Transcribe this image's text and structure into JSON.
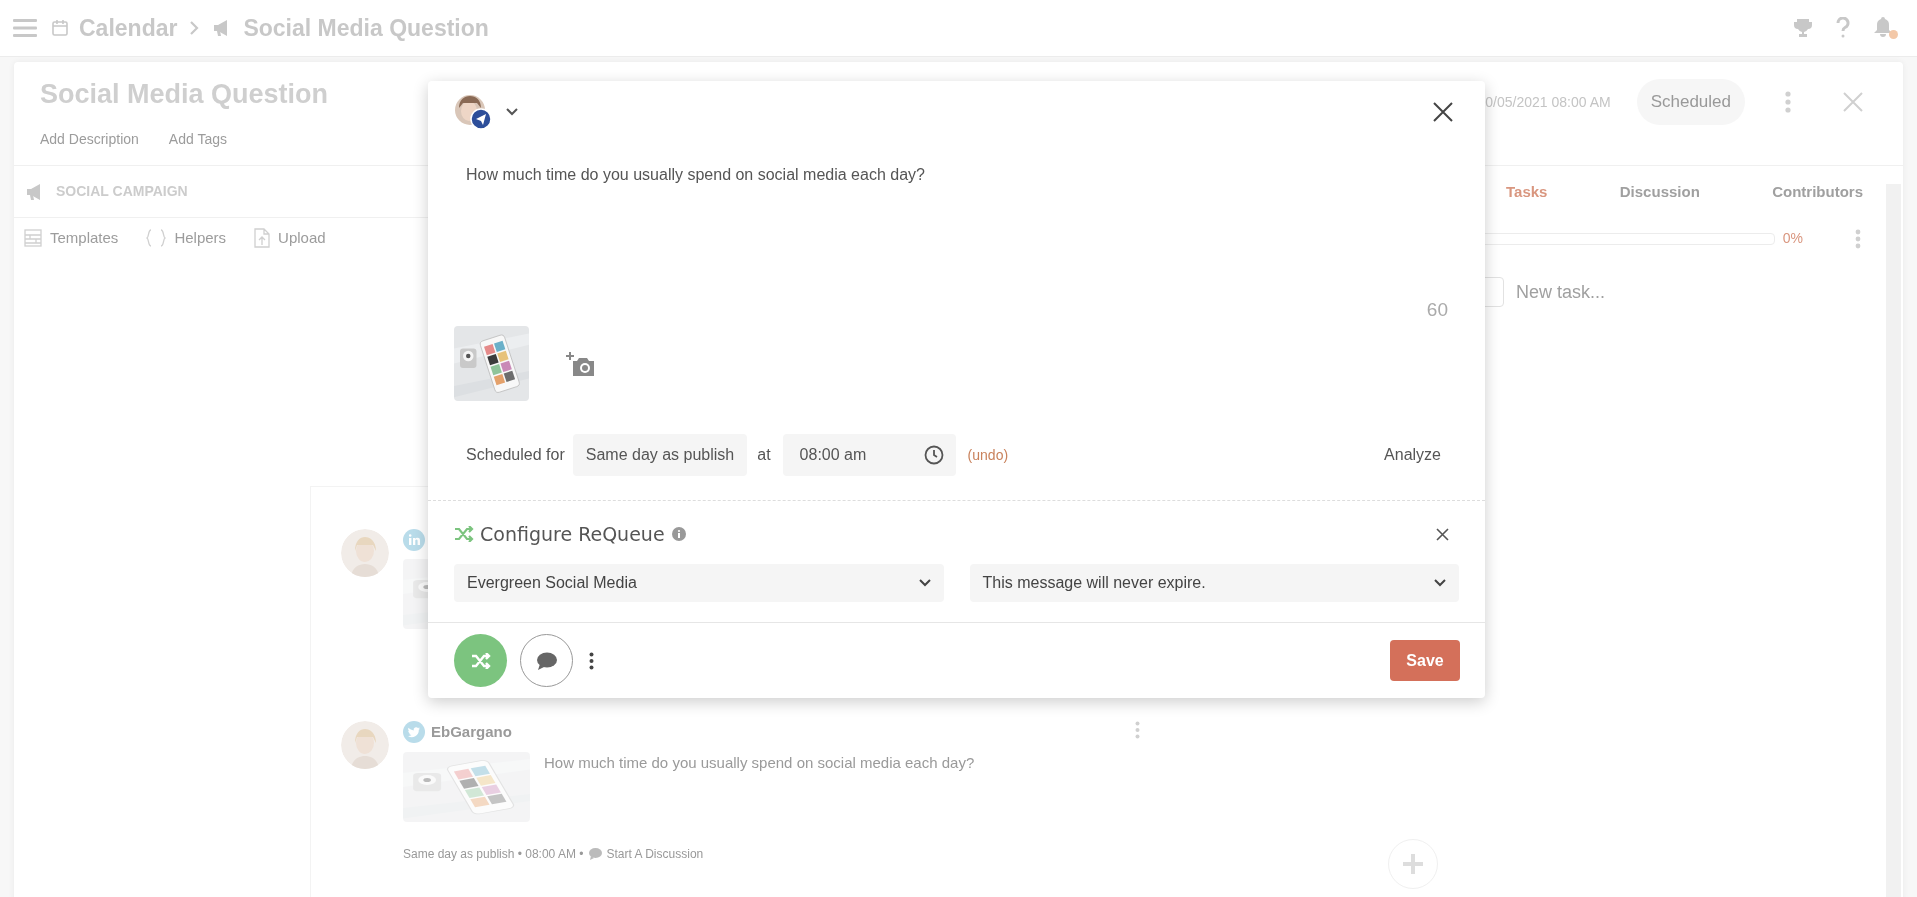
{
  "topbar": {
    "breadcrumbs": [
      {
        "label": "Calendar",
        "kind": "calendar"
      },
      {
        "label": "Social Media Question",
        "kind": "campaign"
      }
    ],
    "notification_dot": true
  },
  "card": {
    "title": "Social Media Question",
    "links": [
      "Add Description",
      "Add Tags"
    ],
    "date": "0/05/2021 08:00 AM",
    "status": "Scheduled"
  },
  "campaign": {
    "heading": "SOCIAL CAMPAIGN",
    "tools": [
      {
        "label": "Templates",
        "kind": "templates"
      },
      {
        "label": "Helpers",
        "kind": "helpers"
      },
      {
        "label": "Upload",
        "kind": "upload"
      }
    ]
  },
  "posts": [
    {
      "kind": "linkedin"
    },
    {
      "kind": "twitter",
      "author": "EbGargano",
      "text": "How much time do you usually spend on social media each day?",
      "meta": "Same day as publish • 08:00 AM •",
      "discussion": "Start A Discussion"
    }
  ],
  "tasks": {
    "tabs": [
      {
        "label": "Tasks",
        "selected": true
      },
      {
        "label": "Discussion",
        "selected": false
      },
      {
        "label": "Contributors",
        "selected": false
      }
    ],
    "level": 0,
    "percent": "0%",
    "placeholder": "New task..."
  },
  "modal": {
    "message": "How much time do you usually spend on social media each day?",
    "count": "60",
    "schedule": {
      "label": "Scheduled for",
      "day": "Same day as publish",
      "at": "at",
      "time": "08:00 am",
      "undo": "(undo)"
    },
    "analyze": "Analyze",
    "requeue": {
      "title": "Configure ReQueue",
      "category": "Evergreen Social Media",
      "expiry": "This message will never expire."
    },
    "footer": {
      "requeue_on": true,
      "save": "Save"
    }
  }
}
